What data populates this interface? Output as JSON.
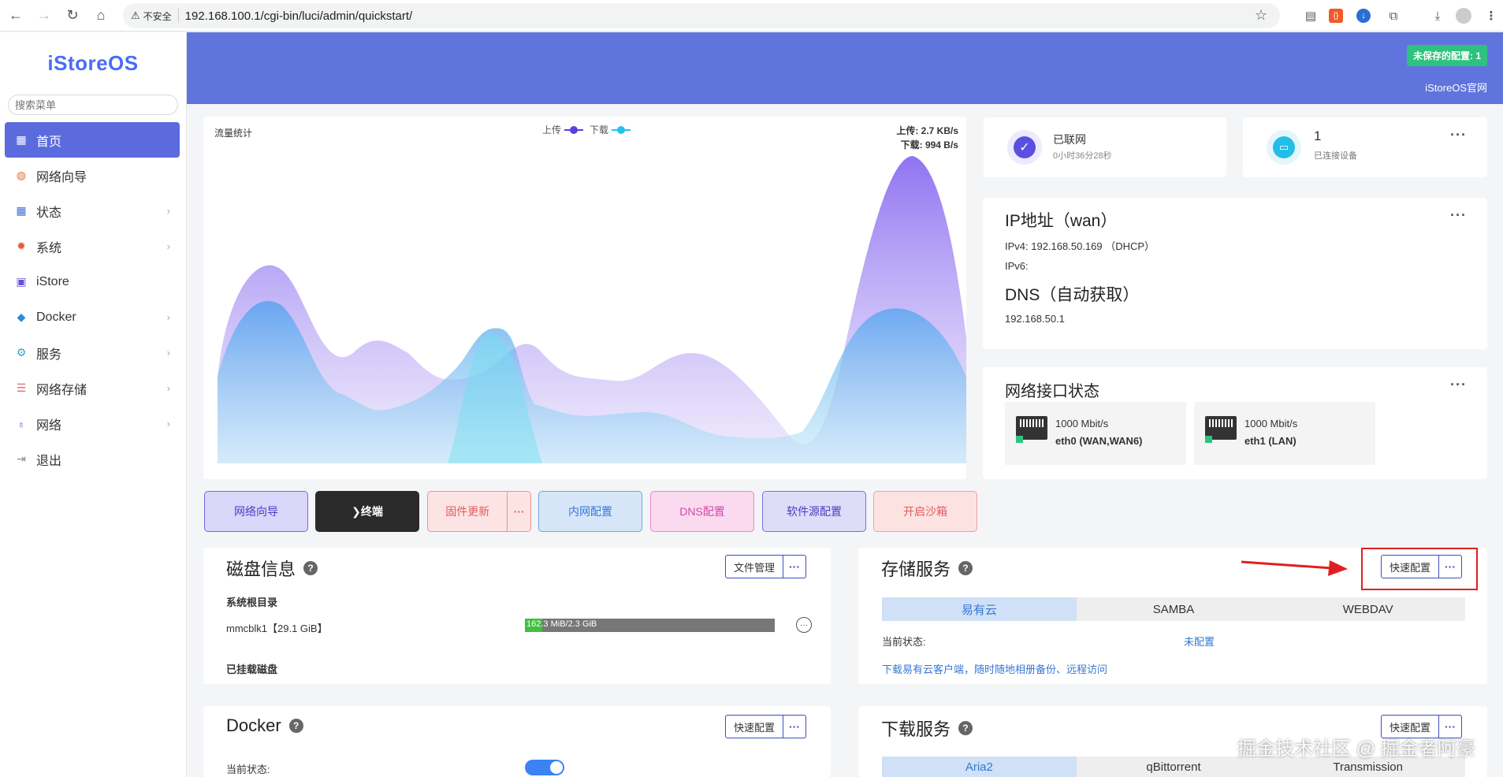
{
  "browser": {
    "security_label": "不安全",
    "url": "192.168.100.1/cgi-bin/luci/admin/quickstart/"
  },
  "sidebar": {
    "logo": "iStoreOS",
    "search_placeholder": "搜索菜单",
    "items": [
      {
        "label": "首页",
        "icon": "dashboard-icon",
        "active": true
      },
      {
        "label": "网络向导",
        "icon": "globe-icon"
      },
      {
        "label": "状态",
        "icon": "grid-icon"
      },
      {
        "label": "系统",
        "icon": "gear-icon"
      },
      {
        "label": "iStore",
        "icon": "bag-icon"
      },
      {
        "label": "Docker",
        "icon": "docker-icon"
      },
      {
        "label": "服务",
        "icon": "cogs-icon"
      },
      {
        "label": "网络存储",
        "icon": "database-icon"
      },
      {
        "label": "网络",
        "icon": "sitemap-icon"
      },
      {
        "label": "退出",
        "icon": "logout-icon"
      }
    ]
  },
  "header": {
    "unsaved": "未保存的配置: 1",
    "official": "iStoreOS官网"
  },
  "traffic": {
    "title": "流量统计",
    "legend_up": "上传",
    "legend_down": "下载",
    "up_rate": "上传: 2.7 KB/s",
    "down_rate": "下载: 994 B/s",
    "colors": {
      "up": "#7b5cf0",
      "down": "#22c3ee"
    }
  },
  "status": {
    "connected": "已联网",
    "uptime": "0小时36分28秒",
    "devices_count": "1",
    "devices_label": "已连接设备"
  },
  "ip": {
    "title": "IP地址（wan）",
    "ipv4": "IPv4: 192.168.50.169 （DHCP）",
    "ipv6": "IPv6:",
    "dns_title": "DNS（自动获取）",
    "dns": "192.168.50.1"
  },
  "interfaces": {
    "title": "网络接口状态",
    "ports": [
      {
        "speed": "1000 Mbit/s",
        "name": "eth0 (WAN,WAN6)"
      },
      {
        "speed": "1000 Mbit/s",
        "name": "eth1 (LAN)"
      }
    ]
  },
  "quick_buttons": [
    {
      "label": "网络向导"
    },
    {
      "label": "❯终端"
    },
    {
      "label": "固件更新"
    },
    {
      "label": "内网配置"
    },
    {
      "label": "DNS配置"
    },
    {
      "label": "软件源配置"
    },
    {
      "label": "开启沙箱"
    }
  ],
  "disk": {
    "title": "磁盘信息",
    "file_mgmt": "文件管理",
    "root_label": "系统根目录",
    "device": "mmcblk1【29.1 GiB】",
    "usage": "162.3 MiB/2.3 GiB",
    "usage_fraction": 0.07,
    "mounted_label": "已挂载磁盘"
  },
  "storage": {
    "title": "存储服务",
    "quick_config": "快速配置",
    "tabs": [
      "易有云",
      "SAMBA",
      "WEBDAV"
    ],
    "status_label": "当前状态:",
    "status_value": "未配置",
    "download_link": "下载易有云客户端，随时随地相册备份、远程访问"
  },
  "docker": {
    "title": "Docker",
    "quick_config": "快速配置",
    "status_label": "当前状态:"
  },
  "download": {
    "title": "下载服务",
    "quick_config": "快速配置",
    "tabs": [
      "Aria2",
      "qBittorrent",
      "Transmission"
    ]
  },
  "watermark": "掘金技术社区 @ 掘金者阿豪"
}
